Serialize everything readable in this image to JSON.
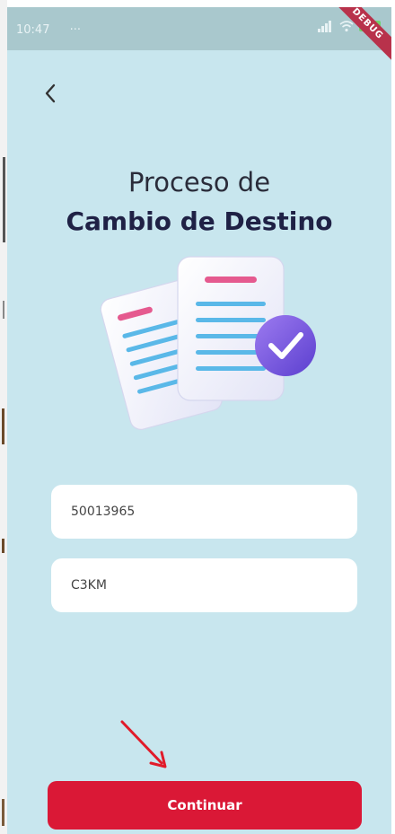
{
  "status_bar": {
    "time": "10:47",
    "extra": "···",
    "debug_label": "DEBUG"
  },
  "header": {
    "back_icon": "chevron-left-icon",
    "title_line1": "Proceso de",
    "title_line2": "Cambio de Destino"
  },
  "form": {
    "field1_value": "50013965",
    "field2_value": "C3KM"
  },
  "actions": {
    "continue_label": "Continuar"
  },
  "colors": {
    "background": "#c8e6ee",
    "primary_button": "#da1836",
    "title_bold": "#1f2145"
  }
}
